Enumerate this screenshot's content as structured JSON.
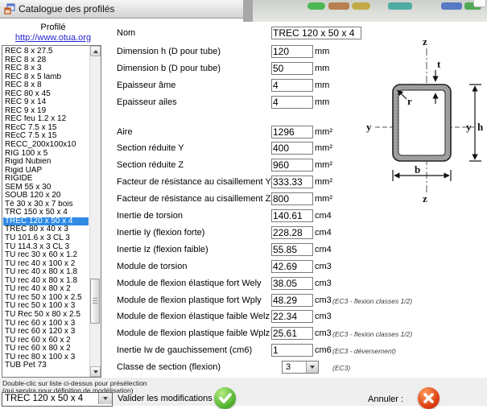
{
  "window": {
    "title": "Catalogue des profilés"
  },
  "desktop": {
    "icon_colors": [
      "#3db544",
      "#b5763f",
      "#bfa435",
      "#3fa7a0",
      "#4a6fc3",
      "#43a447"
    ]
  },
  "profile_panel": {
    "header": "Profilé",
    "link": "http://www.otua.org",
    "items": [
      "REC 8 x 27.5",
      "REC 8 x 28",
      "REC 8 x 3",
      "REC 8 x 5 lamb",
      "REC 8 x 8",
      "REC 80 x 45",
      "REC 9 x 14",
      "REC 9 x 19",
      "REC feu 1.2 x 12",
      "REcC 7.5 x 15",
      "REcC 7.5 x 15",
      "RECC_200x100x10",
      "RIG 100 x 5",
      "Rigid Nubien",
      "Rigid UAP",
      "RIGIDE",
      "SEM 55 x 30",
      "SOUB 120 x 20",
      "Té 30 x 30 x 7 bois",
      "TRC 150 x 50 x 4",
      "TREC 120 x 50 x 4",
      "TREC 80 x 40 x 3",
      "TU 101.6 x 3 CL 3",
      "TU 114.3 x 3 CL 3",
      "TU rec 30 x 60 x 1.2",
      "TU rec 40 x 100 x 2",
      "TU rec 40 x 80 x 1.8",
      "TU rec 40 x 80 x 1.8",
      "TU rec 40 x 80 x 2",
      "TU rec 50 x 100 x 2.5",
      "TU rec 50 x 100 x 3",
      "TU Rec 50 x 80 x 2.5",
      "TU rec 60 x 100 x 3",
      "TU rec 60 x 120 x 3",
      "TU rec 60 x 60 x 2",
      "TU rec 60 x 80 x 2",
      "TU rec 80 x 100 x 3",
      "TUB Pet 73"
    ],
    "selected_index": 20,
    "hint_line1": "Double-clic sur liste ci-dessus pour présélection",
    "hint_line2": "(qui servira pour définition de modélisation)",
    "combo_value": "TREC 120 x 50 x 4"
  },
  "form": {
    "fields": [
      {
        "label": "Nom",
        "value": "TREC 120 x 50 x 4",
        "unit": "",
        "note": "",
        "wide": true
      },
      {
        "label": "Dimension h (D pour tube)",
        "value": "120",
        "unit": "mm",
        "note": ""
      },
      {
        "label": "Dimension b (D pour tube)",
        "value": "50",
        "unit": "mm",
        "note": ""
      },
      {
        "label": "Epaisseur âme",
        "value": "4",
        "unit": "mm",
        "note": ""
      },
      {
        "label": "Epaisseur ailes",
        "value": "4",
        "unit": "mm",
        "note": ""
      },
      {
        "label": "Aire",
        "value": "1296",
        "unit": "mm²",
        "note": ""
      },
      {
        "label": "Section réduite Y",
        "value": "400",
        "unit": "mm²",
        "note": ""
      },
      {
        "label": "Section réduite Z",
        "value": "960",
        "unit": "mm²",
        "note": ""
      },
      {
        "label": "Facteur de résistance au cisaillement Y",
        "value": "333.33",
        "unit": "mm²",
        "note": ""
      },
      {
        "label": "Facteur de résistance au cisaillement Z",
        "value": "800",
        "unit": "mm²",
        "note": ""
      },
      {
        "label": "Inertie de torsion",
        "value": "140.61",
        "unit": "cm4",
        "note": ""
      },
      {
        "label": "Inertie Iy (flexion forte)",
        "value": "228.28",
        "unit": "cm4",
        "note": ""
      },
      {
        "label": "Inertie Iz (flexion faible)",
        "value": "55.85",
        "unit": "cm4",
        "note": ""
      },
      {
        "label": "Module de torsion",
        "value": "42.69",
        "unit": "cm3",
        "note": ""
      },
      {
        "label": "Module de flexion élastique fort Wely",
        "value": "38.05",
        "unit": "cm3",
        "note": ""
      },
      {
        "label": "Module de flexion plastique fort Wply",
        "value": "48.29",
        "unit": "cm3",
        "note": "(EC3 - flexion classes 1/2)"
      },
      {
        "label": "Module de flexion élastique faible Welz",
        "value": "22.34",
        "unit": "cm3",
        "note": ""
      },
      {
        "label": "Module de flexion plastique faible Wplz",
        "value": "25.61",
        "unit": "cm3",
        "note": "(EC3 - flexion classes 1/2)"
      },
      {
        "label": "Inertie Iw de gauchissement (cm6)",
        "value": "1",
        "unit": "cm6",
        "note": "(EC3 - déversement)"
      },
      {
        "label": "Classe de section (flexion)",
        "value": "3",
        "unit": "",
        "note": "(EC3)",
        "type": "select"
      }
    ]
  },
  "footer": {
    "validate_label": "Valider les modifications :",
    "cancel_label": "Annuler :"
  },
  "diagram": {
    "labels": {
      "axis_top": "z",
      "axis_bottom": "z",
      "axis_left": "y",
      "axis_right": "y",
      "height": "h",
      "width": "b",
      "thickness": "t",
      "radius": "r"
    }
  },
  "colors": {
    "selection": "#2f8be4",
    "link": "#2525cc",
    "validate_green": "#53b32f",
    "cancel_red": "#dd3c10"
  }
}
